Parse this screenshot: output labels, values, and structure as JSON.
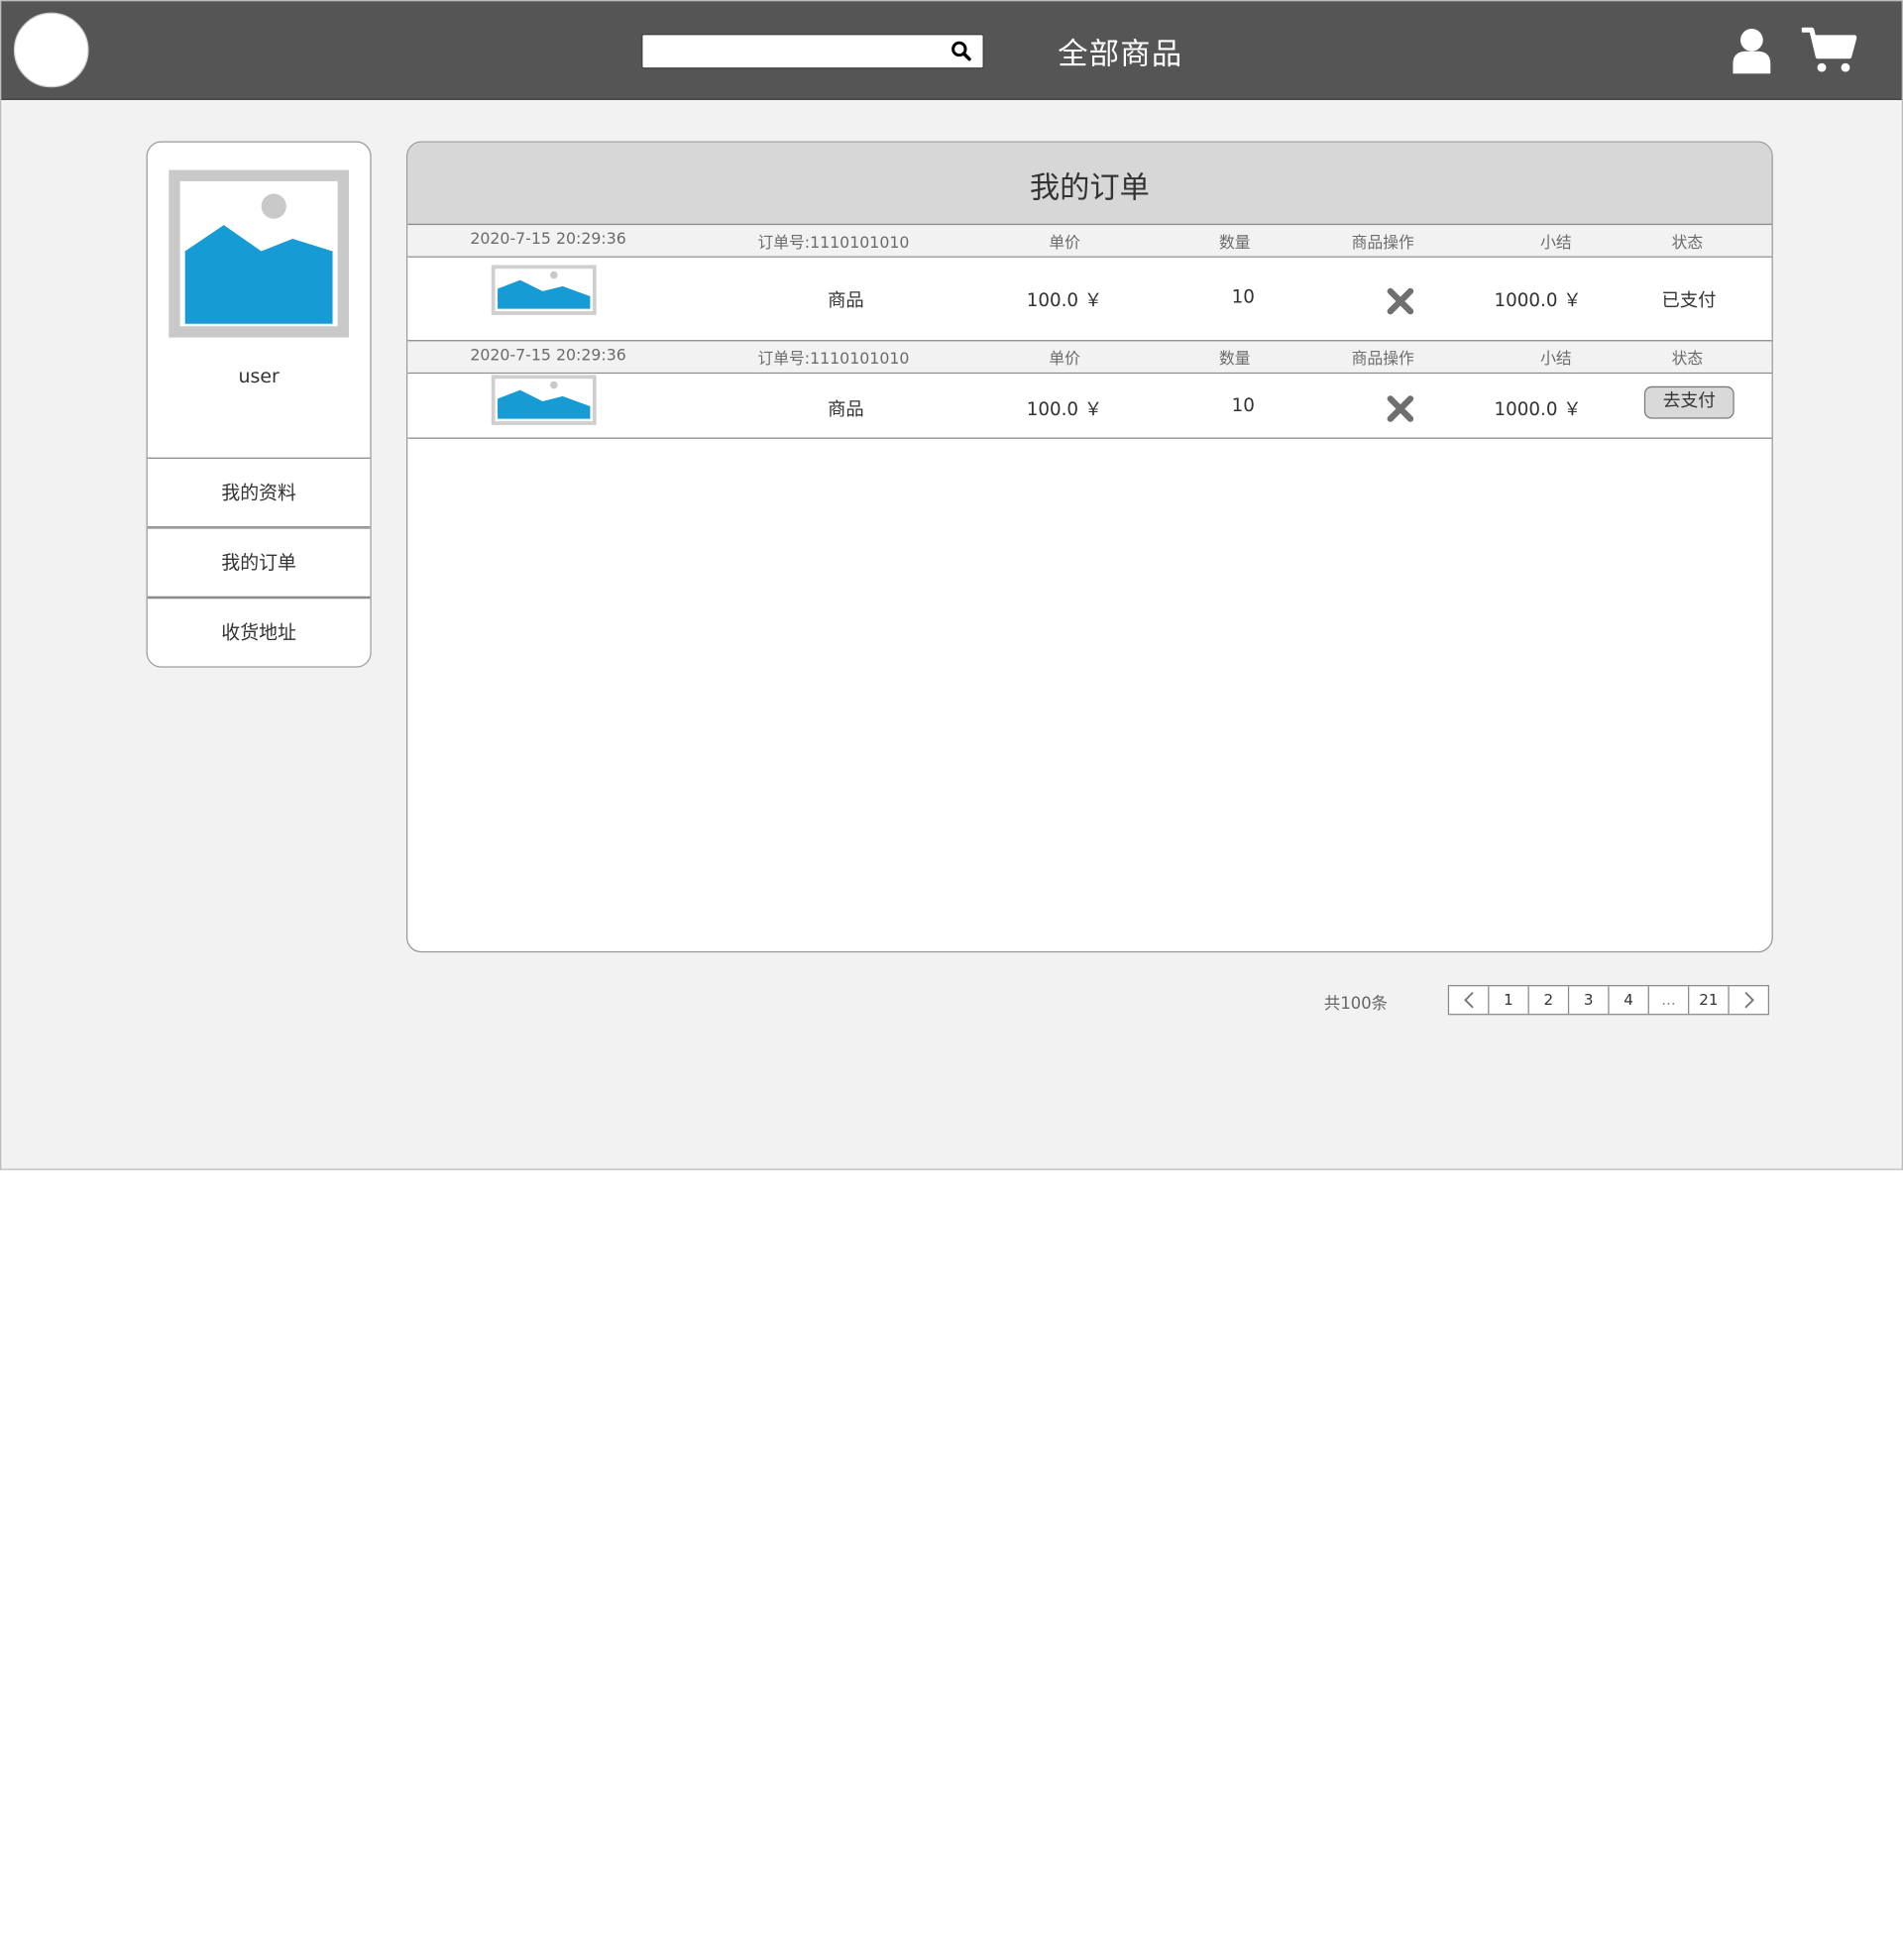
{
  "header": {
    "search_placeholder": "",
    "title": "全部商品"
  },
  "profile": {
    "username": "user",
    "menu": [
      {
        "label": "我的资料"
      },
      {
        "label": "我的订单"
      },
      {
        "label": "收货地址"
      }
    ]
  },
  "orders": {
    "title": "我的订单",
    "rows": [
      {
        "date": "2020-7-15 20:29:36",
        "order_no": "订单号:1110101010",
        "h_price": "单价",
        "h_qty": "数量",
        "h_action": "商品操作",
        "h_subtotal": "小结",
        "h_status": "状态",
        "product": "商品",
        "price": "100.0 ￥",
        "qty": "10",
        "subtotal": "1000.0 ￥",
        "status": "已支付"
      },
      {
        "date": "2020-7-15 20:29:36",
        "order_no": "订单号:1110101010",
        "h_price": "单价",
        "h_qty": "数量",
        "h_action": "商品操作",
        "h_subtotal": "小结",
        "h_status": "状态",
        "product": "商品",
        "price": "100.0 ￥",
        "qty": "10",
        "subtotal": "1000.0 ￥",
        "status_button": "去支付"
      }
    ]
  },
  "pagination": {
    "total": "共100条",
    "pages": [
      "1",
      "2",
      "3",
      "4",
      "...",
      "21"
    ]
  },
  "colors": {
    "header_bg": "#555555",
    "page_bg": "#f2f2f2",
    "image_blue": "#169bd5"
  }
}
